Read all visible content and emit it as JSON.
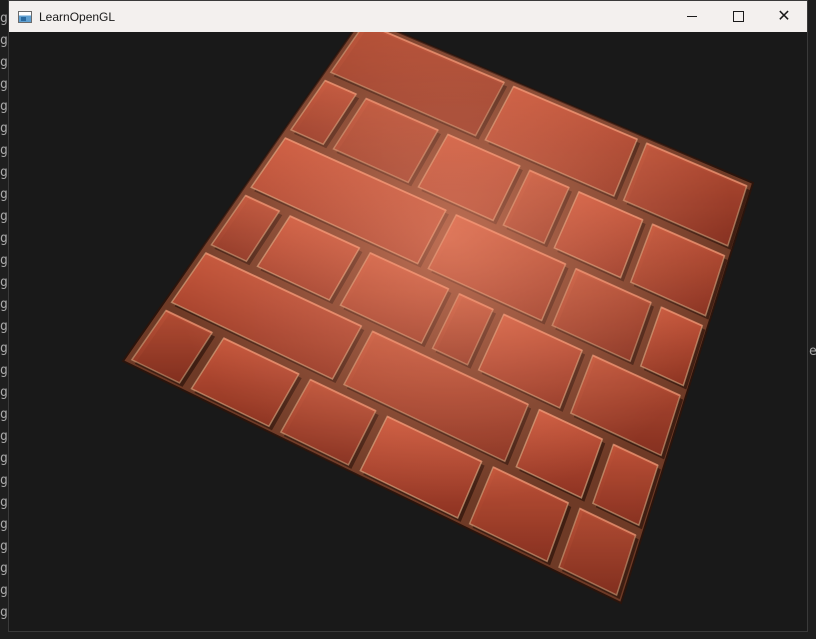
{
  "window": {
    "title": "LearnOpenGL",
    "app_icon": "window-app-icon",
    "controls": {
      "minimize": "minimize-icon",
      "maximize": "maximize-icon",
      "close_glyph": "✕"
    }
  },
  "scene": {
    "description_type": "OpenGL render of a brick wall quad with parallax/normal mapping, rotated in 3D",
    "brick_color": "#b5452f",
    "mortar_color": "#d9b48a",
    "background_color": "#191919"
  },
  "background_terminal": {
    "left_column_char": "g",
    "right_char": "e"
  }
}
